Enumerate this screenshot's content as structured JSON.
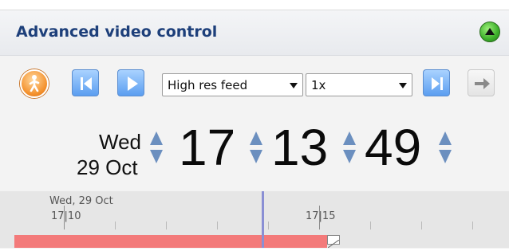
{
  "panel": {
    "title": "Advanced video control"
  },
  "toolbar": {
    "feed_select": {
      "value": "High res feed"
    },
    "speed_select": {
      "value": "1x"
    }
  },
  "datetime": {
    "day_of_week": "Wed",
    "date": "29 Oct",
    "hours": "17",
    "minutes": "13",
    "seconds": "49"
  },
  "timeline": {
    "date_label": "Wed, 29 Oct",
    "tick_labels": [
      "17|10",
      "17|15"
    ]
  },
  "colors": {
    "title": "#1d3f7a",
    "spinner": "#6b8fbf",
    "recording_bar": "#f37a7a",
    "cursor": "#8a8fd4"
  }
}
